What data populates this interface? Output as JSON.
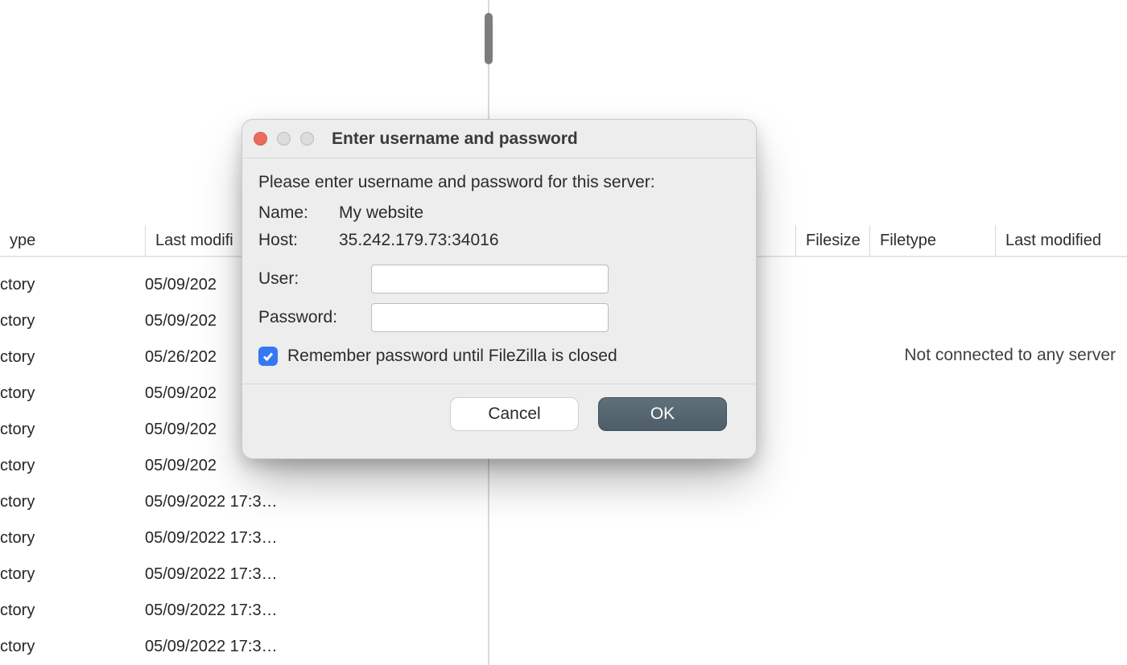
{
  "left_pane": {
    "columns": {
      "type": "ype",
      "modified": "Last modifi"
    },
    "rows": [
      {
        "type": "ctory",
        "modified": "05/09/202"
      },
      {
        "type": "ctory",
        "modified": "05/09/202"
      },
      {
        "type": "ctory",
        "modified": "05/26/202"
      },
      {
        "type": "ctory",
        "modified": "05/09/202"
      },
      {
        "type": "ctory",
        "modified": "05/09/202"
      },
      {
        "type": "ctory",
        "modified": "05/09/202"
      },
      {
        "type": "ctory",
        "modified": "05/09/2022 17:3…"
      },
      {
        "type": "ctory",
        "modified": "05/09/2022 17:3…"
      },
      {
        "type": "ctory",
        "modified": "05/09/2022 17:3…"
      },
      {
        "type": "ctory",
        "modified": "05/09/2022 17:3…"
      },
      {
        "type": "ctory",
        "modified": "05/09/2022 17:3…"
      }
    ]
  },
  "right_pane": {
    "columns": {
      "filesize": "Filesize",
      "filetype": "Filetype",
      "modified": "Last modified"
    },
    "status": "Not connected to any server"
  },
  "dialog": {
    "title": "Enter username and password",
    "prompt": "Please enter username and password for this server:",
    "name_label": "Name:",
    "name_value": "My website",
    "host_label": "Host:",
    "host_value": "35.242.179.73:34016",
    "user_label": "User:",
    "user_value": "",
    "password_label": "Password:",
    "password_value": "",
    "remember_checked": true,
    "remember_label": "Remember password until FileZilla is closed",
    "cancel_label": "Cancel",
    "ok_label": "OK"
  }
}
